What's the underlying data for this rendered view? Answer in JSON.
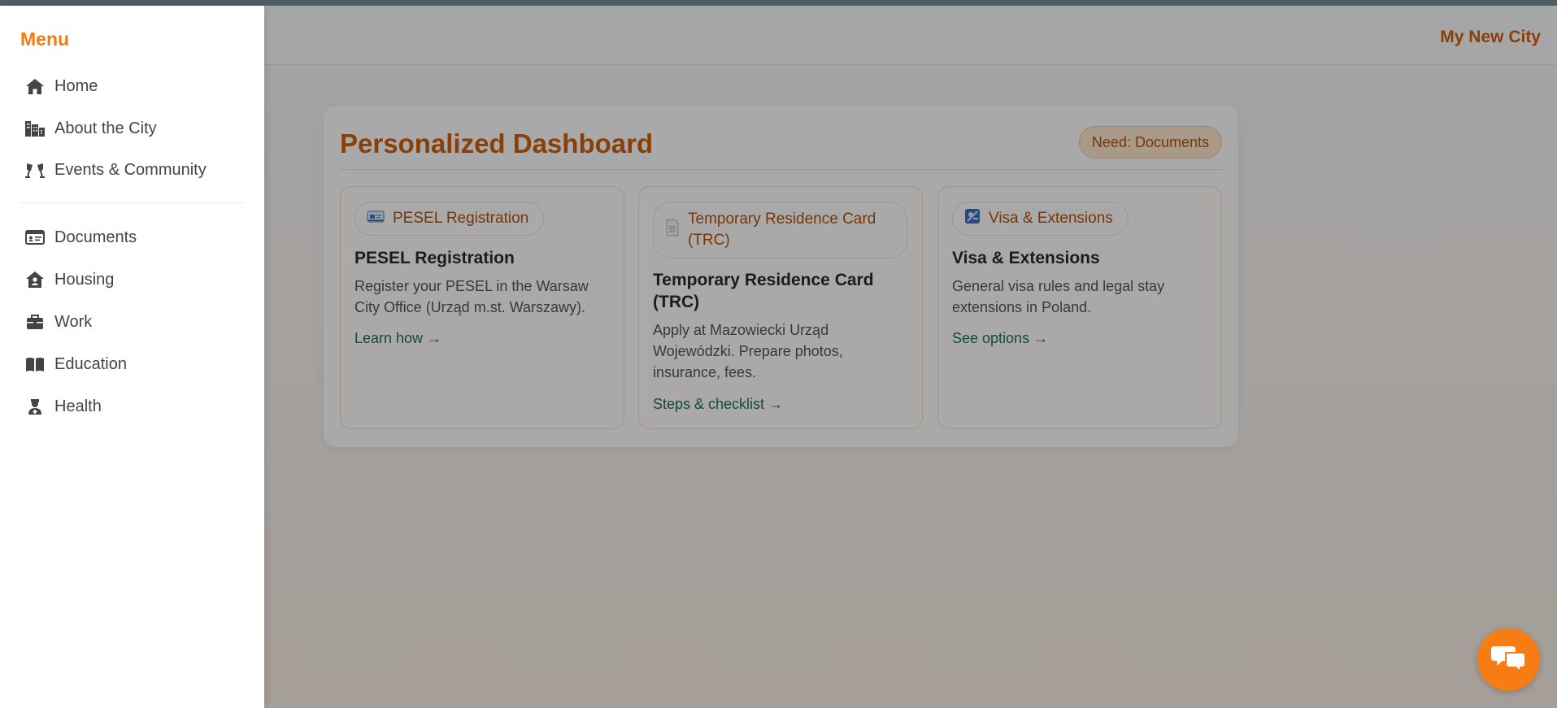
{
  "header": {
    "site_title": "My New City"
  },
  "dashboard": {
    "title": "Personalized Dashboard",
    "need_badge": "Need: Documents",
    "cards": [
      {
        "chip_label": "PESEL Registration",
        "chip_icon": "id-card-icon",
        "title": "PESEL Registration",
        "description": "Register your PESEL in the Warsaw City Office (Urząd m.st. Warszawy).",
        "link": "Learn how →"
      },
      {
        "chip_label": "Temporary Residence Card (TRC)",
        "chip_icon": "document-icon",
        "title": "Temporary Residence Card (TRC)",
        "description": "Apply at Mazowiecki Urząd Wojewódzki. Prepare photos, insurance, fees.",
        "link": "Steps & checklist →"
      },
      {
        "chip_label": "Visa & Extensions",
        "chip_icon": "passport-icon",
        "title": "Visa & Extensions",
        "description": "General visa rules and legal stay extensions in Poland.",
        "link": "See options →"
      }
    ]
  },
  "sidebar": {
    "title": "Menu",
    "items": [
      {
        "label": "Home",
        "icon": "home-icon"
      },
      {
        "label": "About the City",
        "icon": "city-icon"
      },
      {
        "label": "Events & Community",
        "icon": "glasses-cheers-icon"
      },
      {
        "label": "Documents",
        "icon": "id-card-icon"
      },
      {
        "label": "Housing",
        "icon": "house-user-icon"
      },
      {
        "label": "Work",
        "icon": "briefcase-icon"
      },
      {
        "label": "Education",
        "icon": "book-icon"
      },
      {
        "label": "Health",
        "icon": "user-nurse-icon"
      }
    ]
  },
  "chat": {
    "icon": "chat-bubbles-icon"
  },
  "colors": {
    "accent": "#f47c0c",
    "brand_dark": "#cf5f0c",
    "link": "#1d6e5e",
    "overlay": "rgba(0,0,0,0.33)"
  }
}
